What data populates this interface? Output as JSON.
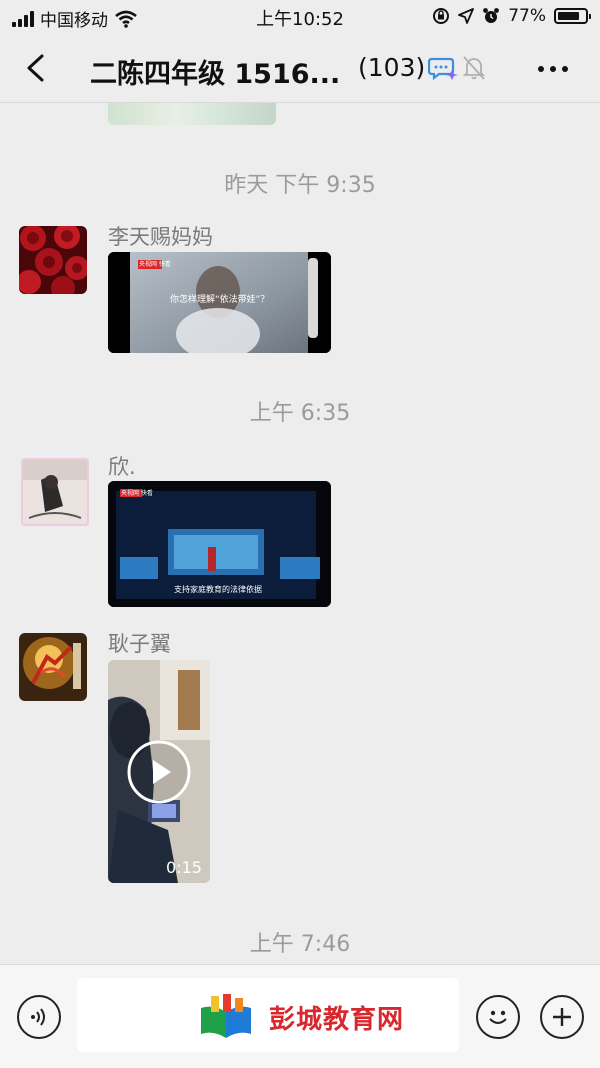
{
  "status_bar": {
    "carrier": "中国移动",
    "time": "上午10:52",
    "battery": "77%"
  },
  "nav": {
    "title": "二陈四年级 1516...",
    "member_count": "(103)"
  },
  "messages": [
    {
      "timestamp": "昨天 下午 9:35",
      "sender": "李天赐妈妈",
      "video_caption": "你怎样理解“依法带娃”？",
      "video_tag": "央视网 快看"
    },
    {
      "timestamp": "上午 6:35",
      "sender": "欣.",
      "video_caption": "支持家庭教育的法律依据",
      "video_tag": "央视网 快看"
    },
    {
      "sender": "耿子翼",
      "video_duration": "0:15"
    }
  ],
  "last_timestamp": "上午 7:46",
  "input": {
    "watermark": "彭城教育网"
  }
}
